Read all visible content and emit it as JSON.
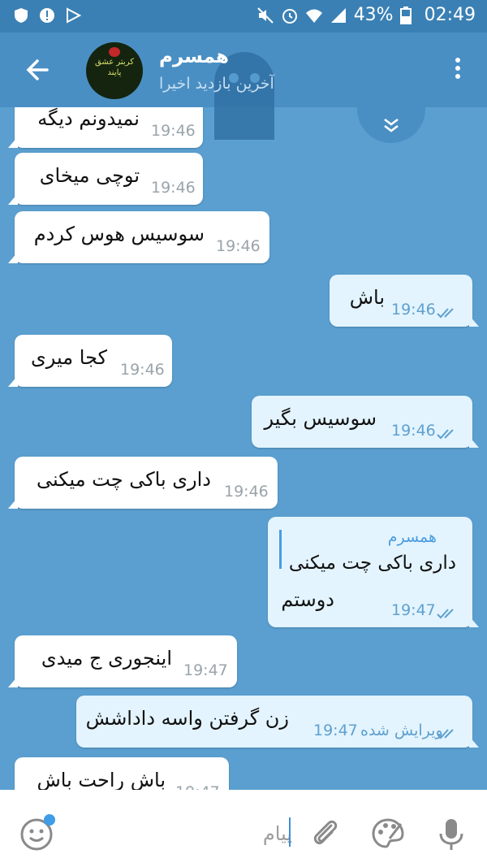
{
  "status_bar": {
    "battery": "43%",
    "time": "02:49",
    "left_icons": [
      "shield-icon",
      "alert-icon",
      "play-store-icon"
    ],
    "right_icons": [
      "mute-icon",
      "alarm-icon",
      "wifi-icon",
      "signal-icon",
      "battery-icon"
    ]
  },
  "header": {
    "contact_name": "همسرم",
    "last_seen": "آخرین بازدید اخیرا",
    "avatar_text": "کربتر عشق پایند"
  },
  "messages": [
    {
      "text": "نمیدونم دیگه",
      "time": "19:46",
      "direction": "in"
    },
    {
      "text": "توچی میخای",
      "time": "19:46",
      "direction": "in"
    },
    {
      "text": "سوسیس هوس کردم",
      "time": "19:46",
      "direction": "in"
    },
    {
      "text": "باش",
      "time": "19:46",
      "direction": "out",
      "read": true
    },
    {
      "text": "کجا میری",
      "time": "19:46",
      "direction": "in"
    },
    {
      "text": "سوسیس بگیر",
      "time": "19:46",
      "direction": "out",
      "read": true
    },
    {
      "text": "داری باکی چت میکنی",
      "time": "19:46",
      "direction": "in"
    },
    {
      "reply_to_name": "همسرم",
      "reply_to_text": "داری باکی چت میکنی",
      "text": "دوستم",
      "time": "19:47",
      "direction": "out",
      "read": true
    },
    {
      "text": "اینجوری ج میدی",
      "time": "19:47",
      "direction": "in"
    },
    {
      "text": "زن گرفتن واسه داداشش",
      "time": "19:47",
      "edited_label": "ویرایش شده",
      "direction": "out",
      "read": true
    },
    {
      "text": "باش راحت باش",
      "time": "19:47",
      "direction": "in"
    }
  ],
  "input": {
    "placeholder": "پیام",
    "value": ""
  },
  "colors": {
    "chat_background": "#5a9fd0",
    "header": "#4a8fc4",
    "status_bar": "#3a80b4",
    "incoming_bubble": "#ffffff",
    "outgoing_bubble": "#e3f4fe",
    "accent": "#3e9de6"
  }
}
